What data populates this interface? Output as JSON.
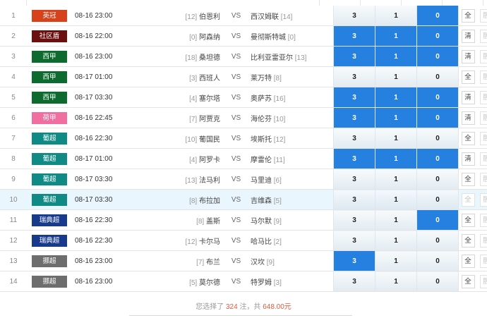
{
  "matches": [
    {
      "idx": "1",
      "league": "英冠",
      "league_color": "#d8421a",
      "time": "08-16 23:00",
      "home_rank": "[12]",
      "home": "伯恩利",
      "vs": "VS",
      "away": "西汉姆联",
      "away_rank": "[14]",
      "odds": [
        "3",
        "1",
        "0"
      ],
      "selected": [
        false,
        false,
        true
      ],
      "btn1": "全",
      "btn2": "胆",
      "btn1_active": true,
      "highlight": false
    },
    {
      "idx": "2",
      "league": "社区盾",
      "league_color": "#6b0f0f",
      "time": "08-16 22:00",
      "home_rank": "[0]",
      "home": "阿森纳",
      "vs": "VS",
      "away": "曼彻斯特城",
      "away_rank": "[0]",
      "odds": [
        "3",
        "1",
        "0"
      ],
      "selected": [
        true,
        true,
        true
      ],
      "btn1": "清",
      "btn2": "胆",
      "btn1_active": true,
      "highlight": false
    },
    {
      "idx": "3",
      "league": "西甲",
      "league_color": "#0e6b2f",
      "time": "08-16 23:00",
      "home_rank": "[18]",
      "home": "桑坦德",
      "vs": "VS",
      "away": "比利亚雷亚尔",
      "away_rank": "[13]",
      "odds": [
        "3",
        "1",
        "0"
      ],
      "selected": [
        true,
        true,
        true
      ],
      "btn1": "清",
      "btn2": "胆",
      "btn1_active": true,
      "highlight": false
    },
    {
      "idx": "4",
      "league": "西甲",
      "league_color": "#0e6b2f",
      "time": "08-17 01:00",
      "home_rank": "[3]",
      "home": "西班人",
      "vs": "VS",
      "away": "莱万特",
      "away_rank": "[8]",
      "odds": [
        "3",
        "1",
        "0"
      ],
      "selected": [
        false,
        false,
        false
      ],
      "btn1": "全",
      "btn2": "胆",
      "btn1_active": true,
      "highlight": false
    },
    {
      "idx": "5",
      "league": "西甲",
      "league_color": "#0e6b2f",
      "time": "08-17 03:30",
      "home_rank": "[4]",
      "home": "塞尔塔",
      "vs": "VS",
      "away": "奥萨苏",
      "away_rank": "[16]",
      "odds": [
        "3",
        "1",
        "0"
      ],
      "selected": [
        true,
        true,
        true
      ],
      "btn1": "清",
      "btn2": "胆",
      "btn1_active": true,
      "highlight": false
    },
    {
      "idx": "6",
      "league": "荷甲",
      "league_color": "#f06ea0",
      "time": "08-16 22:45",
      "home_rank": "[7]",
      "home": "阿贾克",
      "vs": "VS",
      "away": "海伦芬",
      "away_rank": "[10]",
      "odds": [
        "3",
        "1",
        "0"
      ],
      "selected": [
        true,
        true,
        true
      ],
      "btn1": "清",
      "btn2": "胆",
      "btn1_active": true,
      "highlight": false
    },
    {
      "idx": "7",
      "league": "葡超",
      "league_color": "#0f8a84",
      "time": "08-16 22:30",
      "home_rank": "[10]",
      "home": "葡国民",
      "vs": "VS",
      "away": "埃斯托",
      "away_rank": "[12]",
      "odds": [
        "3",
        "1",
        "0"
      ],
      "selected": [
        false,
        false,
        false
      ],
      "btn1": "全",
      "btn2": "胆",
      "btn1_active": true,
      "highlight": false
    },
    {
      "idx": "8",
      "league": "葡超",
      "league_color": "#0f8a84",
      "time": "08-17 01:00",
      "home_rank": "[4]",
      "home": "阿罗卡",
      "vs": "VS",
      "away": "摩雷伦",
      "away_rank": "[11]",
      "odds": [
        "3",
        "1",
        "0"
      ],
      "selected": [
        true,
        true,
        true
      ],
      "btn1": "清",
      "btn2": "胆",
      "btn1_active": true,
      "highlight": false
    },
    {
      "idx": "9",
      "league": "葡超",
      "league_color": "#0f8a84",
      "time": "08-17 03:30",
      "home_rank": "[13]",
      "home": "法马利",
      "vs": "VS",
      "away": "马里迪",
      "away_rank": "[6]",
      "odds": [
        "3",
        "1",
        "0"
      ],
      "selected": [
        false,
        false,
        false
      ],
      "btn1": "全",
      "btn2": "胆",
      "btn1_active": true,
      "highlight": false
    },
    {
      "idx": "10",
      "league": "葡超",
      "league_color": "#0f8a84",
      "time": "08-17 03:30",
      "home_rank": "[8]",
      "home": "布拉加",
      "vs": "VS",
      "away": "吉维森",
      "away_rank": "[5]",
      "odds": [
        "3",
        "1",
        "0"
      ],
      "selected": [
        false,
        false,
        false
      ],
      "btn1": "全",
      "btn2": "胆",
      "btn1_active": false,
      "highlight": true
    },
    {
      "idx": "11",
      "league": "瑞典超",
      "league_color": "#173a8c",
      "time": "08-16 22:30",
      "home_rank": "[8]",
      "home": "盖斯",
      "vs": "VS",
      "away": "马尔默",
      "away_rank": "[9]",
      "odds": [
        "3",
        "1",
        "0"
      ],
      "selected": [
        false,
        false,
        true
      ],
      "btn1": "全",
      "btn2": "胆",
      "btn1_active": true,
      "highlight": false
    },
    {
      "idx": "12",
      "league": "瑞典超",
      "league_color": "#173a8c",
      "time": "08-16 22:30",
      "home_rank": "[12]",
      "home": "卡尔马",
      "vs": "VS",
      "away": "哈马比",
      "away_rank": "[2]",
      "odds": [
        "3",
        "1",
        "0"
      ],
      "selected": [
        false,
        false,
        false
      ],
      "btn1": "全",
      "btn2": "胆",
      "btn1_active": true,
      "highlight": false
    },
    {
      "idx": "13",
      "league": "挪超",
      "league_color": "#6d6d6d",
      "time": "08-16 23:00",
      "home_rank": "[7]",
      "home": "布兰",
      "vs": "VS",
      "away": "汉坎",
      "away_rank": "[9]",
      "odds": [
        "3",
        "1",
        "0"
      ],
      "selected": [
        true,
        false,
        false
      ],
      "btn1": "全",
      "btn2": "胆",
      "btn1_active": true,
      "highlight": false
    },
    {
      "idx": "14",
      "league": "挪超",
      "league_color": "#6d6d6d",
      "time": "08-16 23:00",
      "home_rank": "[5]",
      "home": "莫尔德",
      "vs": "VS",
      "away": "特罗姆",
      "away_rank": "[3]",
      "odds": [
        "3",
        "1",
        "0"
      ],
      "selected": [
        false,
        false,
        false
      ],
      "btn1": "全",
      "btn2": "胆",
      "btn1_active": true,
      "highlight": false
    }
  ],
  "summary": {
    "prefix": "您选择了",
    "count": "324",
    "mid": "注，共",
    "amount": "648.00元"
  },
  "colors": {
    "selected_cell": "#2680e0",
    "highlight_row": "#e9f6fd",
    "amount_text": "#e25b3b"
  }
}
